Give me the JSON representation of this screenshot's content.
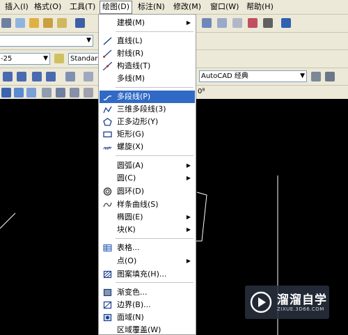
{
  "menubar": {
    "items": [
      {
        "label": "插入(I)"
      },
      {
        "label": "格式(O)"
      },
      {
        "label": "工具(T)"
      },
      {
        "label": "绘图(D)"
      },
      {
        "label": "标注(N)"
      },
      {
        "label": "修改(M)"
      },
      {
        "label": "窗口(W)"
      },
      {
        "label": "帮助(H)"
      }
    ]
  },
  "toolbar": {
    "layer_value": "-25",
    "style_value": "Standar",
    "workspace_value": "AutoCAD 经典",
    "partial_label": "0⁸"
  },
  "draw_menu": {
    "items": [
      {
        "label": "建模(M)",
        "submenu": true
      },
      {
        "label": "直线(L)",
        "icon": "line-icon"
      },
      {
        "label": "射线(R)",
        "icon": "ray-icon"
      },
      {
        "label": "构造线(T)",
        "icon": "construction-line-icon"
      },
      {
        "label": "多线(M)"
      },
      {
        "label": "多段线(P)",
        "icon": "polyline-icon",
        "highlighted": true
      },
      {
        "label": "三维多段线(3)",
        "icon": "3d-polyline-icon"
      },
      {
        "label": "正多边形(Y)",
        "icon": "polygon-icon"
      },
      {
        "label": "矩形(G)",
        "icon": "rectangle-icon"
      },
      {
        "label": "螺旋(X)",
        "icon": "helix-icon"
      },
      {
        "label": "圆弧(A)",
        "submenu": true
      },
      {
        "label": "圆(C)",
        "submenu": true
      },
      {
        "label": "圆环(D)",
        "icon": "donut-icon"
      },
      {
        "label": "样条曲线(S)",
        "icon": "spline-icon"
      },
      {
        "label": "椭圆(E)",
        "submenu": true
      },
      {
        "label": "块(K)",
        "submenu": true
      },
      {
        "label": "表格...",
        "icon": "table-icon"
      },
      {
        "label": "点(O)",
        "submenu": true
      },
      {
        "label": "图案填充(H)...",
        "icon": "hatch-icon"
      },
      {
        "label": "渐变色...",
        "icon": "gradient-icon"
      },
      {
        "label": "边界(B)...",
        "icon": "boundary-icon"
      },
      {
        "label": "面域(N)",
        "icon": "region-icon"
      },
      {
        "label": "区域覆盖(W)"
      }
    ],
    "submenu_arrow": "▶"
  },
  "watermark": {
    "title": "溜溜自学",
    "subtitle": "ZIXUE.3D66.COM"
  },
  "colors": {
    "menu_highlight": "#316AC5",
    "chrome": "#ECE9D8",
    "canvas": "#000000"
  }
}
